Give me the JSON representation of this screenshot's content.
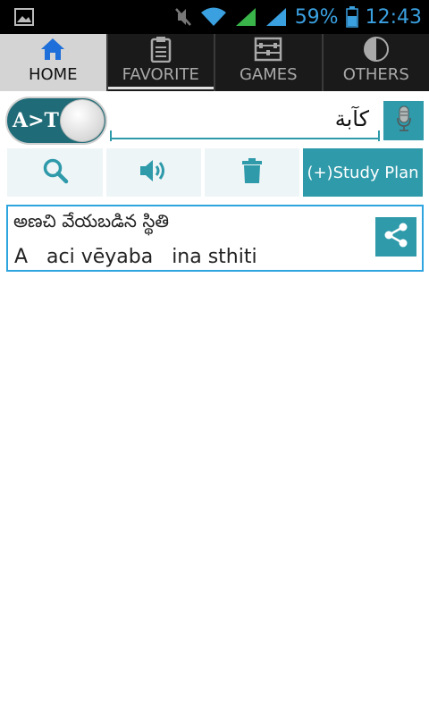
{
  "status_bar": {
    "left_icon": "image-icon",
    "battery_percent": "59%",
    "time": "12:43",
    "icons": [
      "mute-icon",
      "wifi-icon",
      "signal-green-icon",
      "signal-blue-icon",
      "battery-icon"
    ]
  },
  "tabs": [
    {
      "label": "HOME",
      "icon": "home-icon",
      "active": true
    },
    {
      "label": "FAVORITE",
      "icon": "clipboard-icon",
      "active": false
    },
    {
      "label": "GAMES",
      "icon": "abacus-icon",
      "active": false
    },
    {
      "label": "OTHERS",
      "icon": "pie-icon",
      "active": false
    }
  ],
  "toggle": {
    "label": "A>T"
  },
  "search": {
    "value": "كآبة"
  },
  "actions": {
    "study_plan_label": "(+)Study Plan"
  },
  "result": {
    "telugu": "అణచి వేయబడిన స్థితి",
    "transliteration": "A   aci vēyaba   ina sthiti"
  },
  "colors": {
    "accent": "#2e9aaa",
    "card_border": "#2ea5df",
    "toggle_bg": "#1f6b77",
    "button_bg": "#eef5f7",
    "status_blue": "#3aa0e0"
  }
}
